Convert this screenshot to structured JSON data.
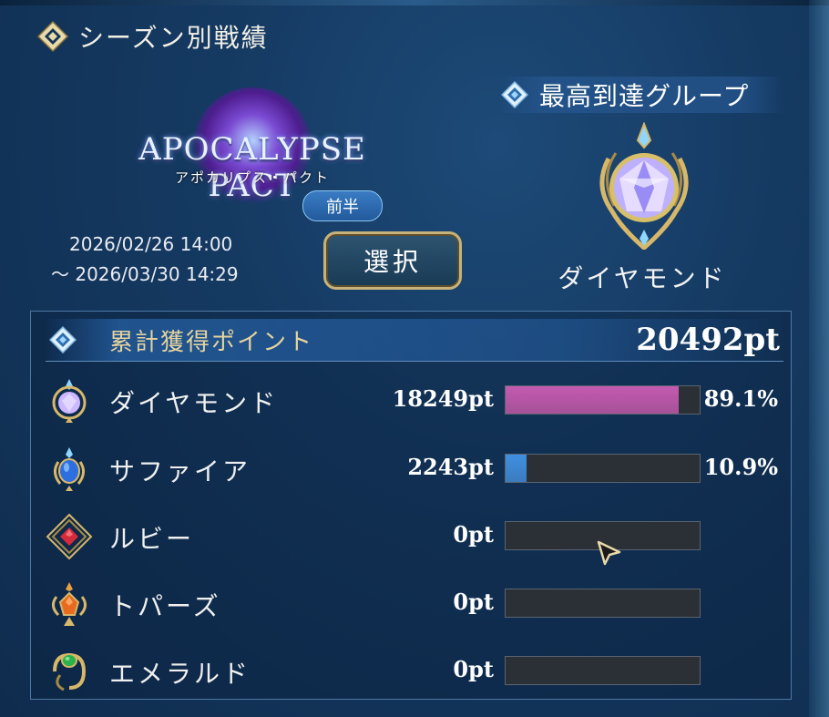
{
  "header": {
    "title": "シーズン別戦績"
  },
  "season": {
    "logo_title": "APOCALYPSE PACT",
    "logo_subtitle": "アポカリプス・パクト",
    "half_badge": "前半",
    "start_date": "2026/02/26 14:00",
    "end_date": "〜 2026/03/30 14:29",
    "select_label": "選択"
  },
  "best_group": {
    "label": "最高到達グループ",
    "name": "ダイヤモンド",
    "gem_color": "#b9a8ff"
  },
  "points": {
    "label": "累計獲得ポイント",
    "total": "20492pt",
    "rows": [
      {
        "name": "ダイヤモンド",
        "points": "18249pt",
        "percent_label": "89.1%",
        "share": 0.891,
        "bar_color": "#c45ab0",
        "gem": "diamond-gem-icon",
        "gem_color": "#cbb8ff"
      },
      {
        "name": "サファイア",
        "points": "2243pt",
        "percent_label": "10.9%",
        "share": 0.109,
        "bar_color": "#3f8fe0",
        "gem": "sapphire-gem-icon",
        "gem_color": "#2d6fe0"
      },
      {
        "name": "ルビー",
        "points": "0pt",
        "percent_label": "",
        "share": 0,
        "bar_color": "#d03040",
        "gem": "ruby-gem-icon",
        "gem_color": "#d42a3a"
      },
      {
        "name": "トパーズ",
        "points": "0pt",
        "percent_label": "",
        "share": 0,
        "bar_color": "#e07a20",
        "gem": "topaz-gem-icon",
        "gem_color": "#e86a1e"
      },
      {
        "name": "エメラルド",
        "points": "0pt",
        "percent_label": "",
        "share": 0,
        "bar_color": "#30b050",
        "gem": "emerald-gem-icon",
        "gem_color": "#2bb24a"
      }
    ]
  }
}
